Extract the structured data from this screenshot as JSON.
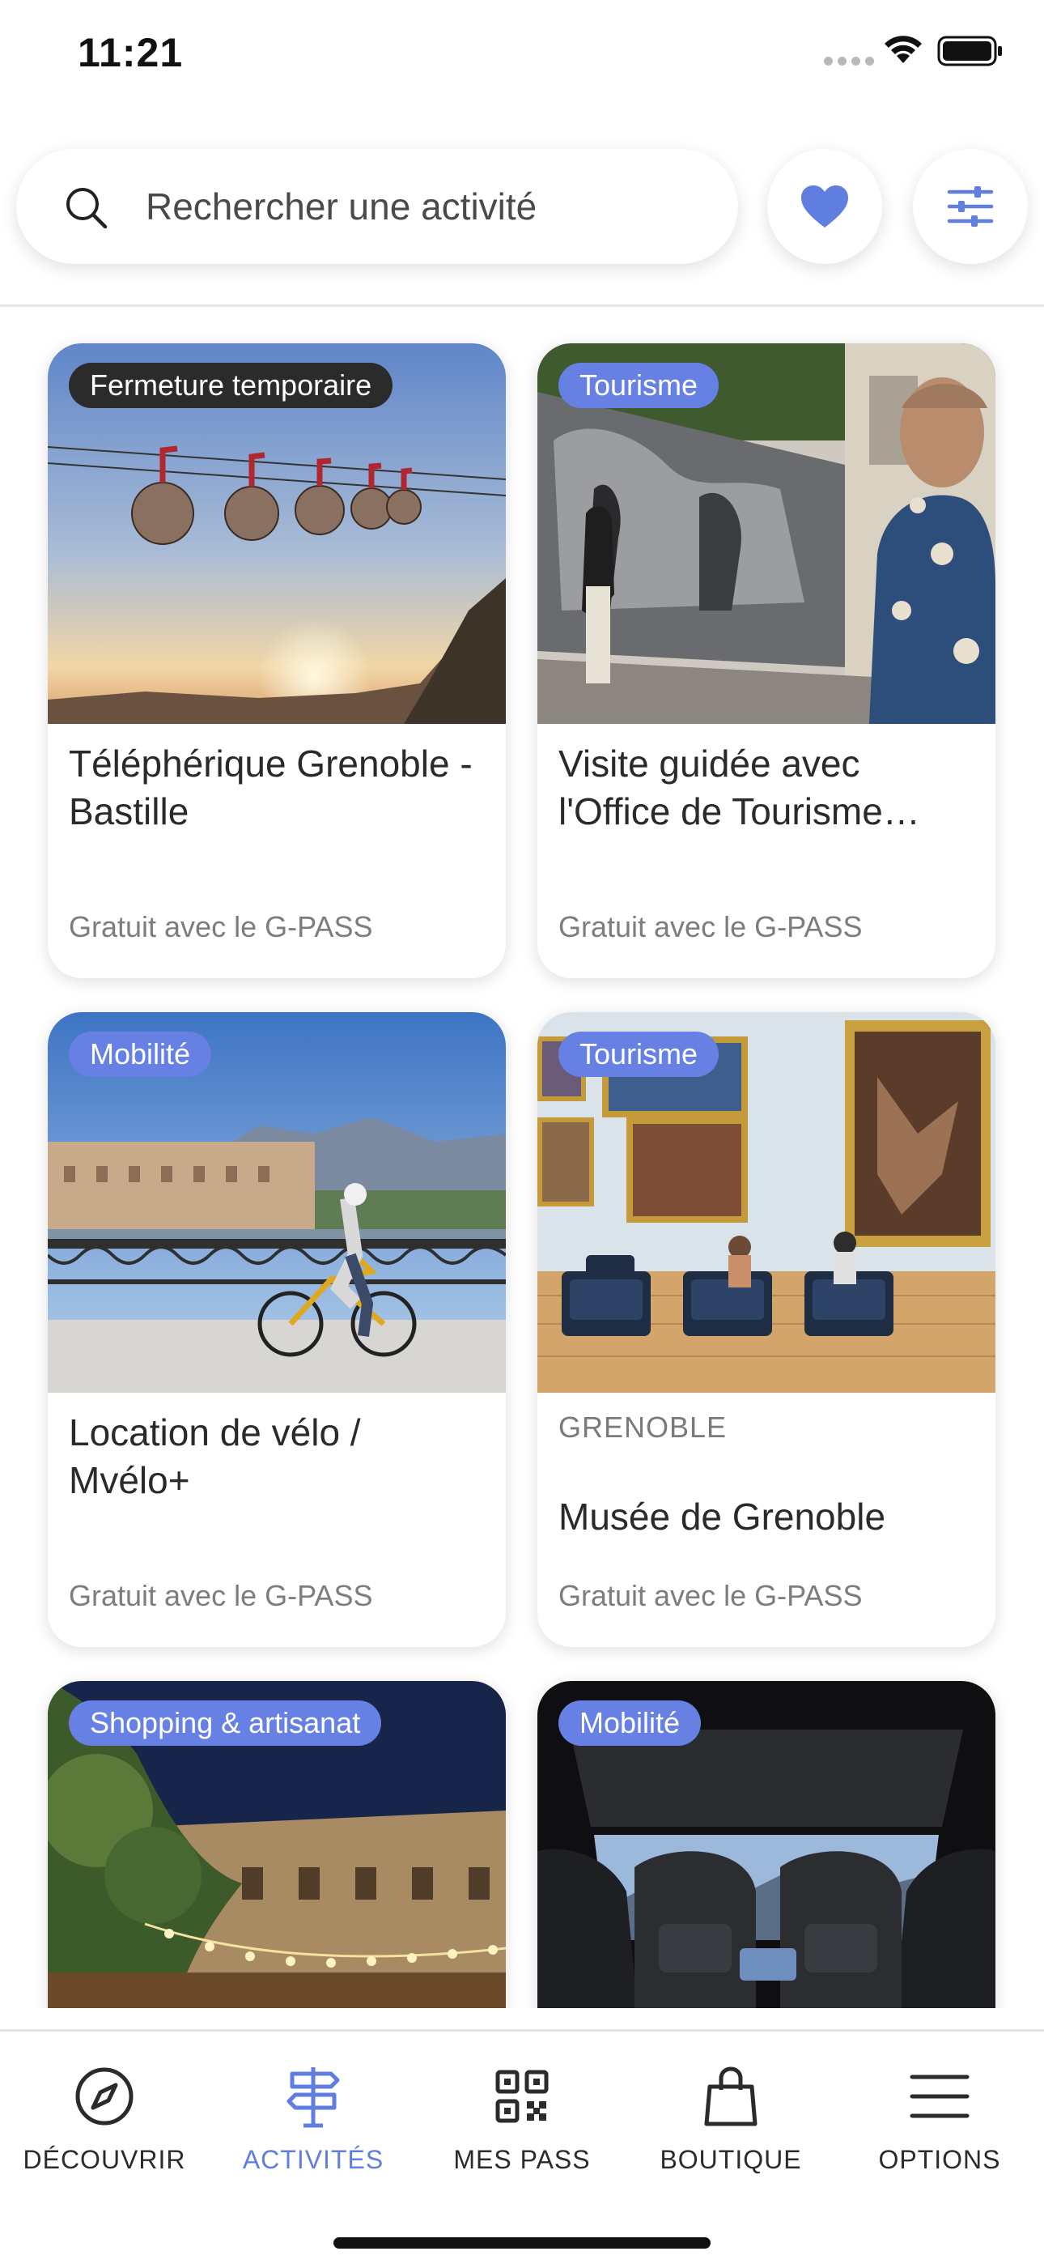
{
  "status_bar": {
    "time": "11:21"
  },
  "search": {
    "placeholder": "Rechercher une activité"
  },
  "colors": {
    "accent": "#6681e3",
    "tag_dark": "#2b2b2b",
    "nav_active": "#5f7ee0"
  },
  "cards": [
    {
      "tag": "Fermeture temporaire",
      "title": "Téléphérique Grenoble - Bastille",
      "city": "",
      "price": "Gratuit avec le G-PASS"
    },
    {
      "tag": "Tourisme",
      "title": "Visite guidée avec l'Office de Tourisme…",
      "city": "",
      "price": "Gratuit avec le G-PASS"
    },
    {
      "tag": "Mobilité",
      "title": "Location de vélo / Mvélo+",
      "city": "",
      "price": "Gratuit avec le G-PASS"
    },
    {
      "tag": "Tourisme",
      "title": "Musée de Grenoble",
      "city": "GRENOBLE",
      "price": "Gratuit avec le G-PASS"
    },
    {
      "tag": "Shopping & artisanat",
      "title": "",
      "city": "",
      "price": ""
    },
    {
      "tag": "Mobilité",
      "title": "",
      "city": "",
      "price": ""
    }
  ],
  "nav": [
    {
      "label": "DÉCOUVRIR",
      "icon": "compass-icon",
      "active": false
    },
    {
      "label": "ACTIVITÉS",
      "icon": "signpost-icon",
      "active": true
    },
    {
      "label": "MES PASS",
      "icon": "qr-code-icon",
      "active": false
    },
    {
      "label": "BOUTIQUE",
      "icon": "shopping-bag-icon",
      "active": false
    },
    {
      "label": "OPTIONS",
      "icon": "menu-icon",
      "active": false
    }
  ]
}
